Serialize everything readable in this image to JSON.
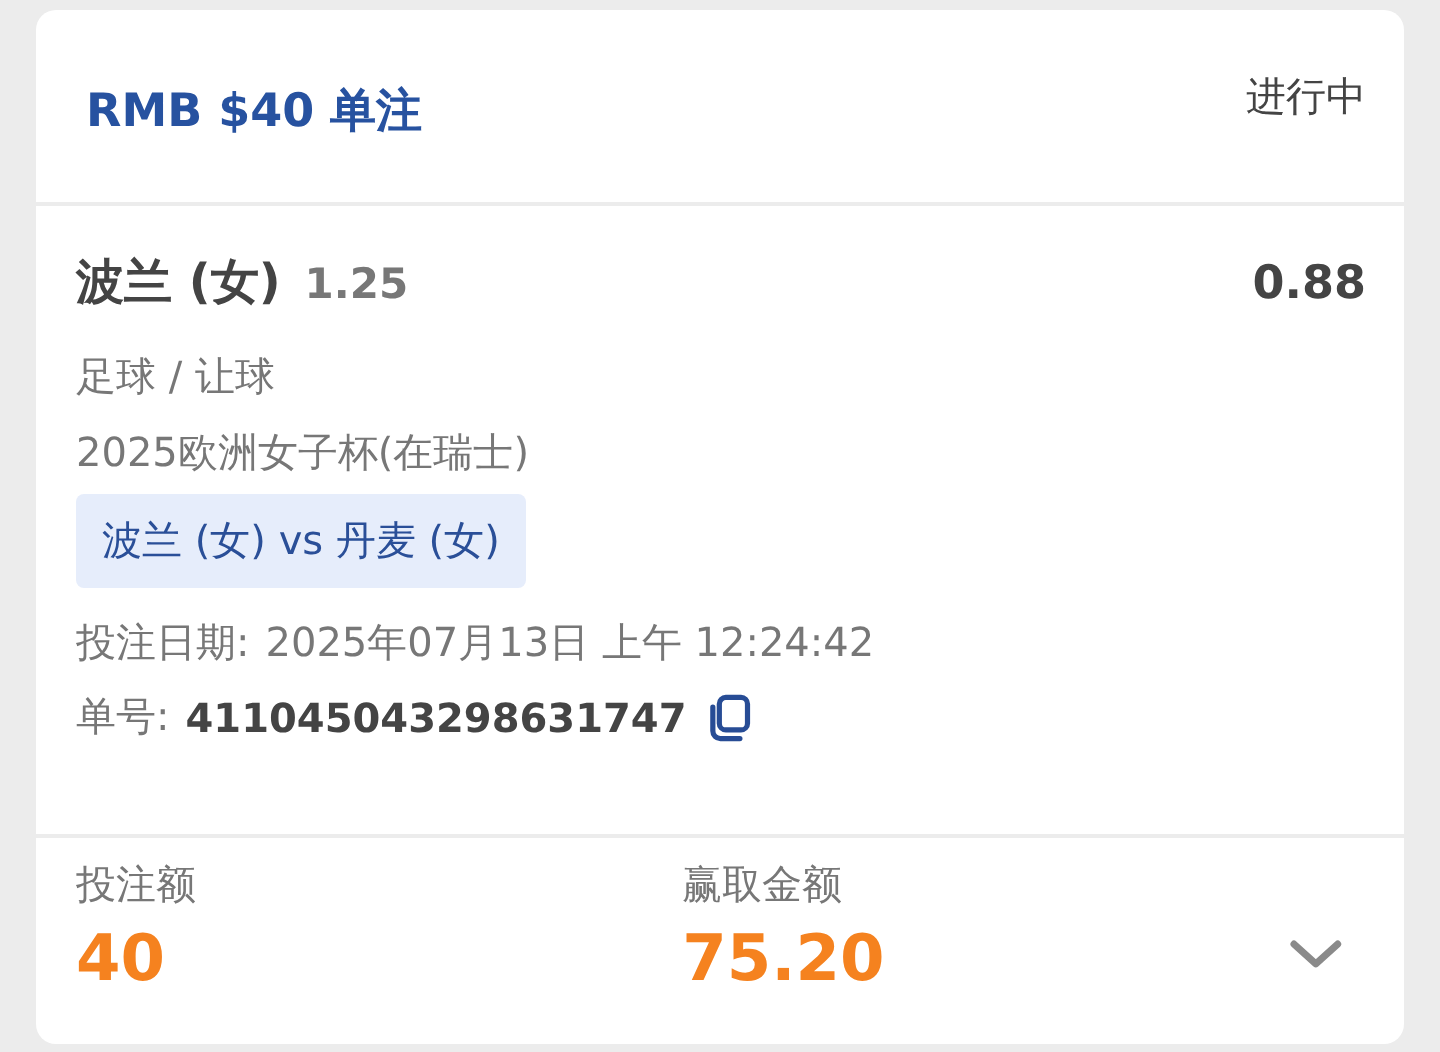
{
  "header": {
    "title": "RMB $40 单注",
    "status": "进行中"
  },
  "selection": {
    "name": "波兰 (女)",
    "handicap": "1.25",
    "odds": "0.88"
  },
  "sport": "足球 / 让球",
  "competition": "2025欧洲女子杯(在瑞士)",
  "match": "波兰 (女) vs 丹麦 (女)",
  "bet_date": {
    "label": "投注日期:",
    "value": "2025年07月13日 上午 12:24:42"
  },
  "ticket": {
    "label": "单号:",
    "value": "411045043298631747"
  },
  "footer": [
    {
      "label": "投注额",
      "value": "40"
    },
    {
      "label": "赢取金额",
      "value": "75.20"
    }
  ],
  "expanded": false
}
